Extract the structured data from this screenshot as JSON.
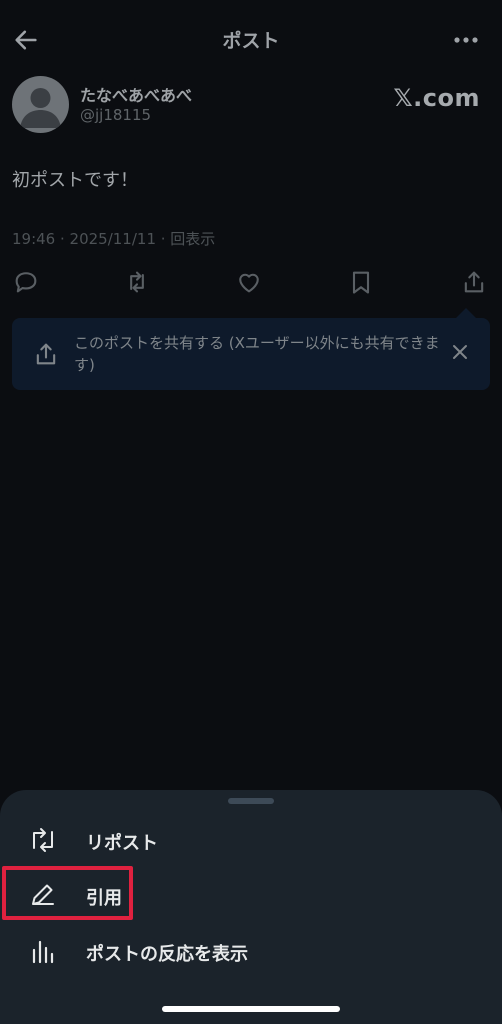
{
  "header": {
    "title": "ポスト"
  },
  "author": {
    "name": "たなべあべあべ",
    "handle": "@jj18115",
    "brand": "𝕏.com"
  },
  "post": {
    "text": "初ポストです！",
    "meta": "19:46 · 2025/11/11 · 回表示"
  },
  "tooltip": {
    "text": "このポストを共有する (Xユーザー以外にも共有できます)"
  },
  "sheet": {
    "items": [
      {
        "label": "リポスト",
        "icon": "repost-icon"
      },
      {
        "label": "引用",
        "icon": "quote-pencil-icon"
      },
      {
        "label": "ポストの反応を表示",
        "icon": "analytics-icon"
      }
    ]
  },
  "colors": {
    "background": "#0b0d11",
    "sheet": "#1b232b",
    "highlight": "#e0213f",
    "tooltip": "#0e1a2b"
  }
}
